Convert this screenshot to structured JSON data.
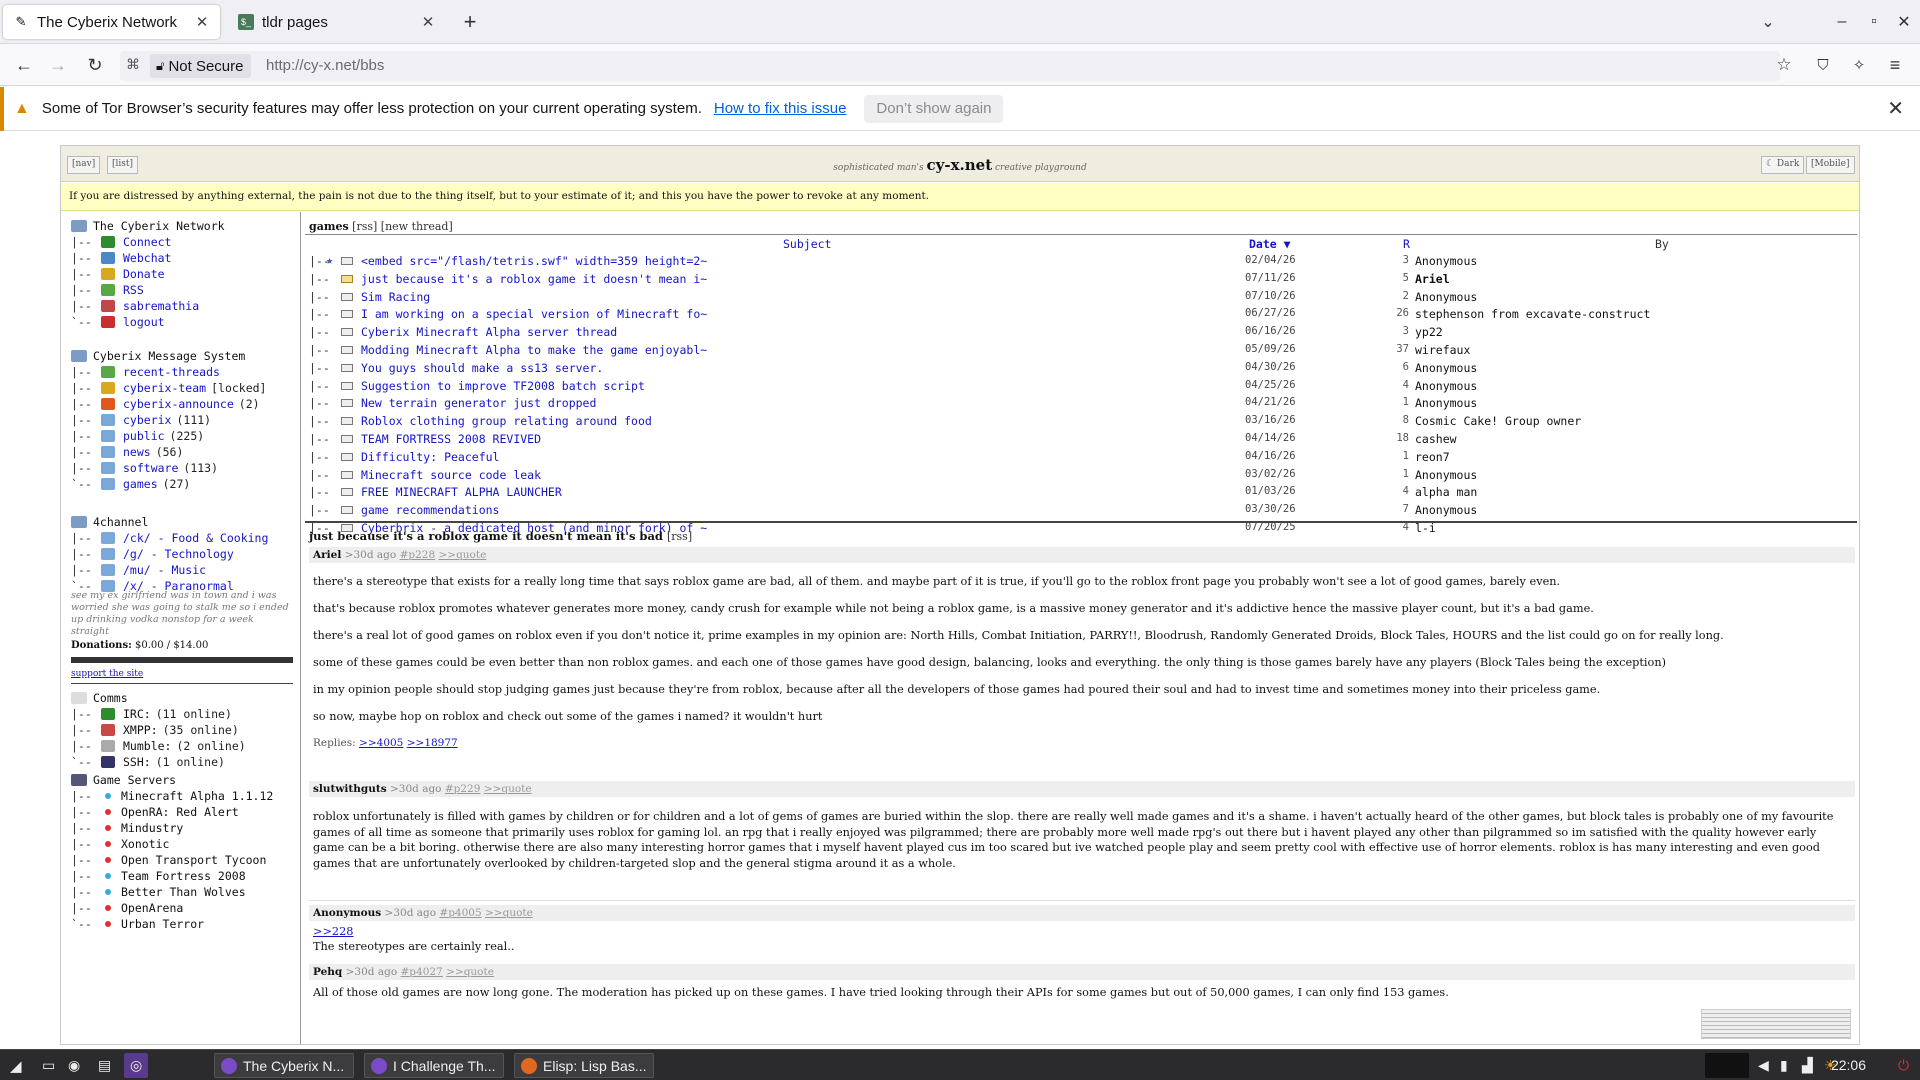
{
  "browser": {
    "tabs": [
      {
        "title": "The Cyberix Network",
        "active": true
      },
      {
        "title": "tldr pages",
        "active": false
      }
    ],
    "new_tab": "+",
    "tab_list": "⌄",
    "win_min": "–",
    "win_max": "▫",
    "win_close": "✕",
    "not_secure": "Not Secure",
    "url": "http://cy-x.net/bbs"
  },
  "notification": {
    "message": "Some of Tor Browser’s security features may offer less protection on your current operating system.",
    "fix_link": "How to fix this issue",
    "dont_show": "Don’t show again",
    "close": "✕"
  },
  "site": {
    "nav_btn": "[nav]",
    "list_btn": "[list]",
    "tagline_pre": "sophisticated man's",
    "brand": "cy-x.net",
    "tagline_post": "creative playground",
    "dark_btn": "☾ Dark",
    "mobile_btn": "[Mobile]",
    "quote": "If you are distressed by anything external, the pain is not due to the thing itself, but to your estimate of it; and this you have the power to revoke at any moment."
  },
  "sidebar": {
    "network": {
      "root": "The Cyberix Network",
      "items": [
        {
          "pre": "|--",
          "label": "Connect",
          "color": "#2e8b2e"
        },
        {
          "pre": "|--",
          "label": "Webchat",
          "color": "#4a88c8"
        },
        {
          "pre": "|--",
          "label": "Donate",
          "color": "#d8a820"
        },
        {
          "pre": "|--",
          "label": "RSS",
          "color": "#58a848"
        },
        {
          "pre": "|--",
          "label": "sabremathia",
          "color": "#c04848"
        },
        {
          "pre": "`--",
          "label": "logout",
          "color": "#c83030"
        }
      ]
    },
    "bbs": {
      "root": "Cyberix Message System",
      "items": [
        {
          "pre": "|--",
          "label": "recent-threads",
          "extra": "",
          "color": "#58a848"
        },
        {
          "pre": "|--",
          "label": "cyberix-team",
          "extra": "[locked]",
          "color": "#d8a820"
        },
        {
          "pre": "|--",
          "label": "cyberix-announce",
          "extra": "(2)",
          "color": "#e05820"
        },
        {
          "pre": "|--",
          "label": "cyberix",
          "extra": "(111)",
          "color": "#7aa8d8"
        },
        {
          "pre": "|--",
          "label": "public",
          "extra": "(225)",
          "color": "#7aa8d8"
        },
        {
          "pre": "|--",
          "label": "news",
          "extra": "(56)",
          "color": "#7aa8d8"
        },
        {
          "pre": "|--",
          "label": "software",
          "extra": "(113)",
          "color": "#7aa8d8"
        },
        {
          "pre": "`--",
          "label": "games",
          "extra": "(27)",
          "color": "#7aa8d8"
        }
      ]
    },
    "fourchan": {
      "root": "4channel",
      "items": [
        {
          "pre": "|--",
          "label": "/ck/ - Food & Cooking"
        },
        {
          "pre": "|--",
          "label": "/g/ - Technology"
        },
        {
          "pre": "|--",
          "label": "/mu/ - Music"
        },
        {
          "pre": "`--",
          "label": "/x/ - Paranormal"
        }
      ]
    },
    "blurb": "see my ex girlfriend was in town and i was worried she was going to stalk me so i ended up drinking vodka nonstop for a week straight",
    "donations_label": "Donations:",
    "donations_value": "$0.00 / $14.00",
    "support": "support the site",
    "comms": {
      "root": "Comms",
      "items": [
        {
          "pre": "|--",
          "label": "IRC:",
          "status": "(11 online)",
          "color": "#2e8b2e"
        },
        {
          "pre": "|--",
          "label": "XMPP:",
          "status": "(35 online)",
          "color": "#c84848"
        },
        {
          "pre": "|--",
          "label": "Mumble:",
          "status": "(2 online)",
          "color": "#aaaaaa"
        },
        {
          "pre": "`--",
          "label": "SSH:",
          "status": "(1 online)",
          "color": "#333366"
        }
      ]
    },
    "servers": {
      "root": "Game Servers",
      "items": [
        {
          "pre": "|--",
          "label": "Minecraft Alpha 1.1.12",
          "up": true
        },
        {
          "pre": "|--",
          "label": "OpenRA: Red Alert",
          "up": false
        },
        {
          "pre": "|--",
          "label": "Mindustry",
          "up": false
        },
        {
          "pre": "|--",
          "label": "Xonotic",
          "up": false
        },
        {
          "pre": "|--",
          "label": "Open Transport Tycoon",
          "up": false
        },
        {
          "pre": "|--",
          "label": "Team Fortress 2008",
          "up": true
        },
        {
          "pre": "|--",
          "label": "Better Than Wolves",
          "up": true
        },
        {
          "pre": "|--",
          "label": "OpenArena",
          "up": false
        },
        {
          "pre": "`--",
          "label": "Urban Terror",
          "up": false
        }
      ],
      "up_color": "#3aa8e0",
      "down_color": "#e03030"
    }
  },
  "board": {
    "name": "games",
    "rss": "[rss]",
    "new_thread": "[new thread]",
    "col_subject": "Subject",
    "col_date": "Date ▼",
    "col_r": "R",
    "col_by": "By",
    "threads": [
      {
        "subject": "<embed src=\"/flash/tetris.swf\" width=359 height=2~",
        "date": "02/04/26",
        "r": "3",
        "by": "Anonymous",
        "sticky": true
      },
      {
        "subject": "just because it's a roblox game it doesn't mean i~",
        "date": "07/11/26",
        "r": "5",
        "by": "Ariel",
        "bold": true,
        "open": true
      },
      {
        "subject": "Sim Racing",
        "date": "07/10/26",
        "r": "2",
        "by": "Anonymous"
      },
      {
        "subject": "I am working on a special version of Minecraft fo~",
        "date": "06/27/26",
        "r": "26",
        "by": "stephenson from excavate-construct"
      },
      {
        "subject": "Cyberix Minecraft Alpha server thread",
        "date": "06/16/26",
        "r": "3",
        "by": "yp22"
      },
      {
        "subject": "Modding Minecraft Alpha to make the game enjoyabl~",
        "date": "05/09/26",
        "r": "37",
        "by": "wirefaux"
      },
      {
        "subject": "You guys should make a ss13 server.",
        "date": "04/30/26",
        "r": "6",
        "by": "Anonymous"
      },
      {
        "subject": "Suggestion to improve TF2008 batch script",
        "date": "04/25/26",
        "r": "4",
        "by": "Anonymous"
      },
      {
        "subject": "New terrain generator just dropped",
        "date": "04/21/26",
        "r": "1",
        "by": "Anonymous"
      },
      {
        "subject": "Roblox clothing group relating around food",
        "date": "03/16/26",
        "r": "8",
        "by": "Cosmic Cake! Group owner"
      },
      {
        "subject": "TEAM FORTRESS 2008 REVIVED",
        "date": "04/14/26",
        "r": "18",
        "by": "cashew"
      },
      {
        "subject": "Difficulty: Peaceful",
        "date": "04/16/26",
        "r": "1",
        "by": "reon7"
      },
      {
        "subject": "Minecraft source code leak",
        "date": "03/02/26",
        "r": "1",
        "by": "Anonymous"
      },
      {
        "subject": "FREE MINECRAFT ALPHA LAUNCHER",
        "date": "01/03/26",
        "r": "4",
        "by": "alpha man"
      },
      {
        "subject": "game recommendations",
        "date": "03/30/26",
        "r": "7",
        "by": "Anonymous"
      },
      {
        "subject": "Cyberbrix - a dedicated host (and minor fork) of ~",
        "date": "07/20/25",
        "r": "4",
        "by": "l-i"
      }
    ]
  },
  "open_thread": {
    "title": "just because it's a roblox game it doesn't mean it's bad",
    "rss": "[rss]",
    "posts": [
      {
        "author": "Ariel",
        "age": ">30d ago",
        "id": "#p228",
        "quote": ">>quote",
        "paragraphs": [
          "there's a stereotype that exists for a really long time that says roblox game are bad, all of them. and maybe part of it is true, if you'll go to the roblox front page you probably won't see a lot of good games, barely even.",
          "that's because roblox promotes whatever generates more money, candy crush for example while not being a roblox game, is a massive money generator and it's addictive hence the massive player count, but it's a bad game.",
          "there's a real lot of good games on roblox even if you don't notice it, prime examples in my opinion are: North Hills, Combat Initiation, PARRY!!, Bloodrush, Randomly Generated Droids, Block Tales, HOURS and the list could go on for really long.",
          "some of these games could be even better than non roblox games. and each one of those games have good design, balancing, looks and everything. the only thing is those games barely have any players (Block Tales being the exception)",
          "in my opinion people should stop judging games just because they're from roblox, because after all the developers of those games had poured their soul and had to invest time and sometimes money into their priceless game.",
          "so now, maybe hop on roblox and check out some of the games i named? it wouldn't hurt"
        ],
        "replies_label": "Replies:",
        "replies": [
          ">>4005",
          ">>18977"
        ]
      },
      {
        "author": "slutwithguts",
        "age": ">30d ago",
        "id": "#p229",
        "quote": ">>quote",
        "paragraphs": [
          "roblox unfortunately is filled with games by children or for children and a lot of gems of games are buried within the slop. there are really well made games and it's a shame. i haven't actually heard of the other games, but block tales is probably one of my favourite games of all time as someone that primarily uses roblox for gaming lol. an rpg that i really enjoyed was pilgrammed; there are probably more well made rpg's out there but i havent played any other than pilgrammed so im satisfied with the quality however early game can be a bit boring. otherwise there are also many interesting horror games that i myself havent played cus im too scared but ive watched people play and seem pretty cool with effective use of horror elements. roblox is has many interesting and even good games that are unfortunately overlooked by children-targeted slop and the general stigma around it as a whole."
        ]
      },
      {
        "author": "Anonymous",
        "age": ">30d ago",
        "id": "#p4005",
        "quote": ">>quote",
        "ref": ">>228",
        "paragraphs": [
          "The stereotypes are certainly real.."
        ]
      },
      {
        "author": "Pehq",
        "age": ">30d ago",
        "id": "#p4027",
        "quote": ">>quote",
        "paragraphs": [
          "All of those old games are now long gone. The moderation has picked up on these games. I have tried looking through their APIs for some games but out of 50,000 games, I can only find 153 games."
        ]
      }
    ]
  },
  "taskbar": {
    "tasks": [
      "The Cyberix N...",
      "I Challenge Th...",
      "Elisp: Lisp Bas..."
    ],
    "clock": "22:06"
  }
}
